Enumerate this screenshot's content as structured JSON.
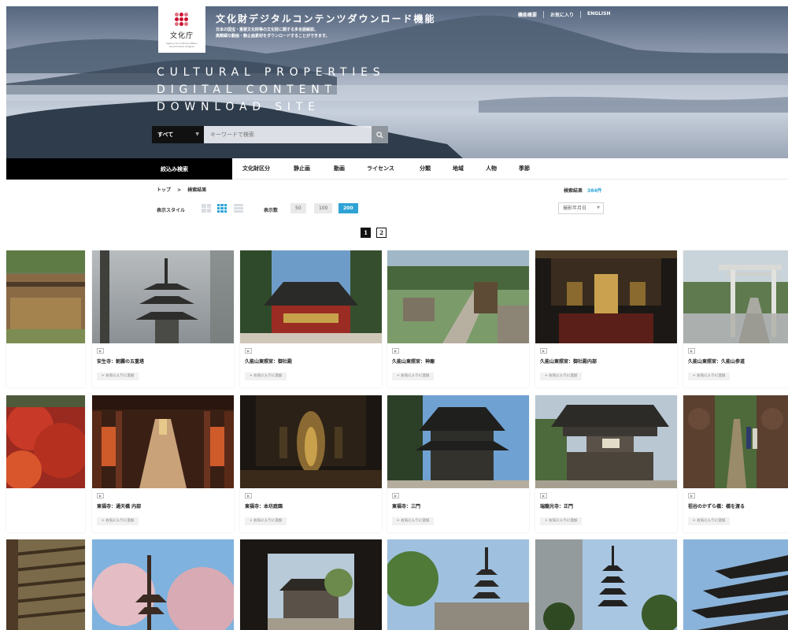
{
  "header": {
    "logo_text": "文化庁",
    "logo_sub": "Agency for Cultural Affairs, Government of Japan",
    "site_title": "文化財デジタルコンテンツダウンロード機能",
    "desc_line1": "日本の国宝・重要文化財等の文化財に関する多言語解説、",
    "desc_line2": "高精細な動画・静止画素材をダウンロードすることができます。",
    "links": [
      "機能概要",
      "お気に入り",
      "ENGLISH"
    ],
    "title_line1": "CULTURAL PROPERTIES",
    "title_line2": "DIGITAL CONTENT",
    "title_line3": "DOWNLOAD SITE"
  },
  "search": {
    "category": "すべて",
    "placeholder": "キーワードで検索"
  },
  "nav": {
    "filter_label": "絞込み検索",
    "items": [
      "文化財区分",
      "静止画",
      "動画",
      "ライセンス",
      "分類",
      "地域",
      "人物",
      "季節"
    ]
  },
  "toolbar": {
    "breadcrumb_top": "トップ",
    "breadcrumb_sep": ">",
    "breadcrumb_current": "検索結果",
    "result_label": "検索結果",
    "result_count": "384件",
    "style_label": "表示スタイル",
    "count_label": "表示数",
    "counts": [
      "50",
      "100",
      "200"
    ],
    "active_count": "200",
    "sort_value": "撮影年月日",
    "pages": [
      "1",
      "2"
    ]
  },
  "cards": {
    "tag": "▶",
    "fav_label": "+ お気に入りに追加",
    "row1": [
      "",
      "安生寺：朝霧の五重塔",
      "久能山東照宮：御社殿",
      "久能山東照宮：神廟",
      "久能山東照宮：御社殿内部",
      "久能山東照宮：久能山参道"
    ],
    "row2": [
      "",
      "東福寺：通天橋 内部",
      "東福寺：本坊庭園",
      "東福寺：三門",
      "瑞龍光寺：正門",
      "祖谷のかずら橋：橋を渡る"
    ]
  },
  "colors": {
    "accent": "#2ea3d6",
    "nav_black": "#000000",
    "logo_red": "#c9102c"
  }
}
